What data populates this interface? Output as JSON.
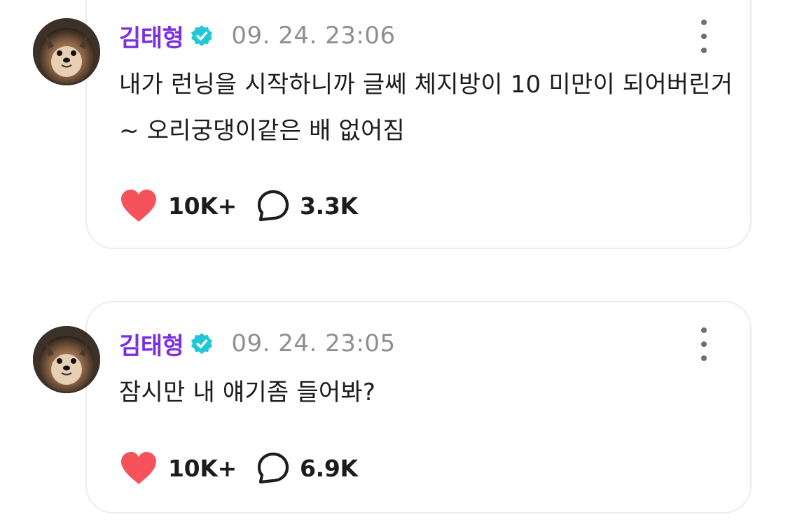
{
  "posts": [
    {
      "author": "김태형",
      "timestamp": "09. 24. 23:06",
      "text": "내가 런닝을 시작하니까 글쎄 체지방이 10 미만이 되어버린거~ 오리궁댕이같은 배 없어짐",
      "likes": "10K+",
      "comments": "3.3K"
    },
    {
      "author": "김태형",
      "timestamp": "09. 24. 23:05",
      "text": "잠시만 내 얘기좀 들어봐?",
      "likes": "10K+",
      "comments": "6.9K"
    }
  ],
  "icons": {
    "verified": "verified-badge-icon",
    "more": "more-vertical-icon",
    "like": "heart-icon",
    "comment": "speech-bubble-icon"
  },
  "colors": {
    "author": "#7b2fe0",
    "verified": "#1ec8d6",
    "heart": "#f6525b",
    "timestamp": "#8e8e93"
  }
}
